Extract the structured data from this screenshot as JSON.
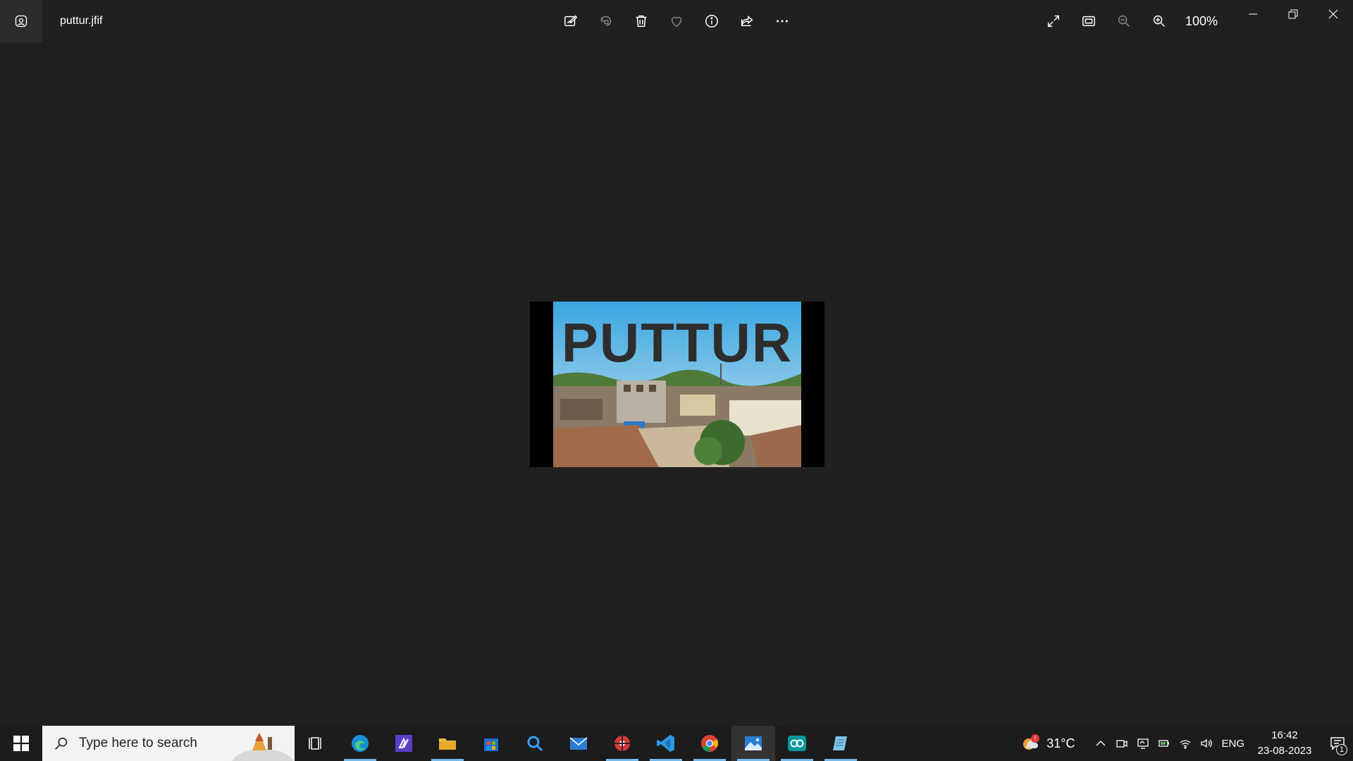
{
  "window": {
    "filename": "puttur.jfif",
    "zoom_level": "100%"
  },
  "toolbar": {
    "items": [
      {
        "name": "edit-image",
        "icon": "edit-image-icon"
      },
      {
        "name": "rotate",
        "icon": "rotate-icon",
        "disabled": true
      },
      {
        "name": "delete",
        "icon": "trash-icon"
      },
      {
        "name": "favorite",
        "icon": "heart-icon",
        "disabled": true
      },
      {
        "name": "file-info",
        "icon": "info-icon"
      },
      {
        "name": "share",
        "icon": "share-icon"
      },
      {
        "name": "see-more",
        "icon": "more-icon"
      }
    ]
  },
  "image": {
    "overlay_text": "PUTTUR"
  },
  "taskbar": {
    "search_placeholder": "Type here to search",
    "apps": [
      "task-view",
      "edge",
      "visual-studio",
      "file-explorer",
      "microsoft-store",
      "search-app",
      "mail",
      "app-red",
      "vs-code",
      "chrome",
      "photos",
      "arduino",
      "notepad"
    ],
    "weather_temp": "31°C",
    "language": "ENG",
    "time": "16:42",
    "date": "23-08-2023",
    "notification_count": "1"
  },
  "colors": {
    "background": "#202020",
    "taskbar": "#1c1c1c",
    "accent_underline": "#76b9ed"
  }
}
